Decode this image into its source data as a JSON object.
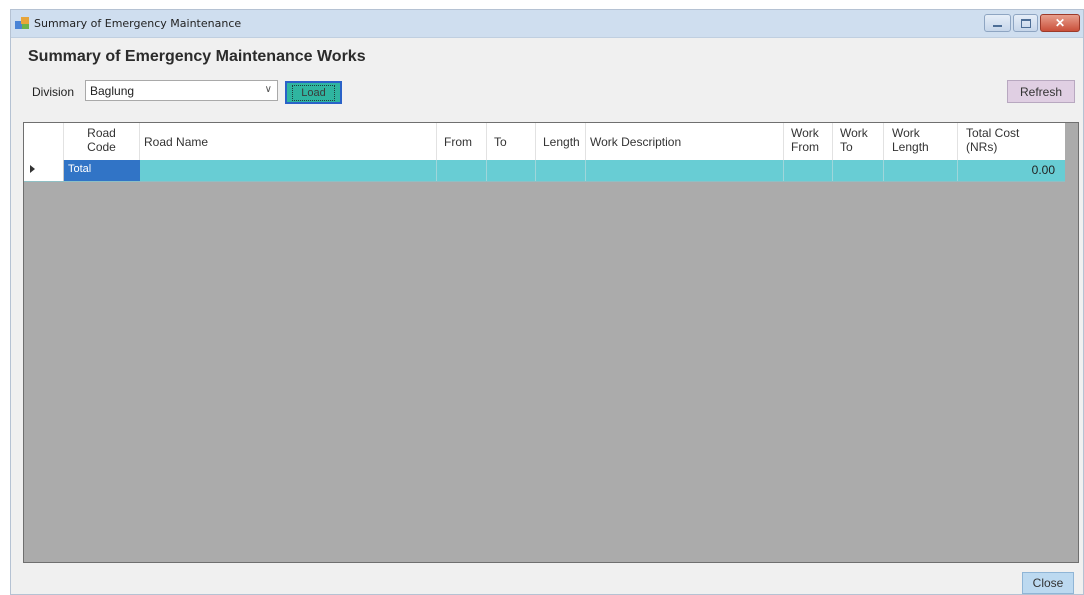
{
  "window": {
    "title": "Summary of Emergency Maintenance"
  },
  "form": {
    "heading": "Summary of Emergency Maintenance Works",
    "division_label": "Division",
    "division_value": "Baglung",
    "load_label": "Load",
    "refresh_label": "Refresh",
    "close_label": "Close"
  },
  "grid": {
    "columns": [
      {
        "label": "Road\nCode"
      },
      {
        "label": "Road Name"
      },
      {
        "label": "From"
      },
      {
        "label": "To"
      },
      {
        "label": "Length"
      },
      {
        "label": "Work Description"
      },
      {
        "label": "Work\nFrom"
      },
      {
        "label": "Work\nTo"
      },
      {
        "label": "Work\nLength"
      },
      {
        "label": "Total Cost\n(NRs)"
      }
    ],
    "rows": [
      {
        "road_code": "Total",
        "total_cost": "0.00"
      }
    ]
  },
  "colors": {
    "selected_row": "#68cdd4",
    "selected_cell": "#3174c6",
    "grid_background": "#ababab",
    "load_button": "#2fb5a0",
    "refresh_button": "#e0cfe3",
    "close_button": "#bcd9f0"
  },
  "icons": {
    "app": "app-window-icon",
    "minimize": "minimize-icon",
    "maximize": "maximize-icon",
    "close": "close-icon",
    "dropdown": "chevron-down-icon",
    "row_pointer": "row-pointer-icon"
  }
}
